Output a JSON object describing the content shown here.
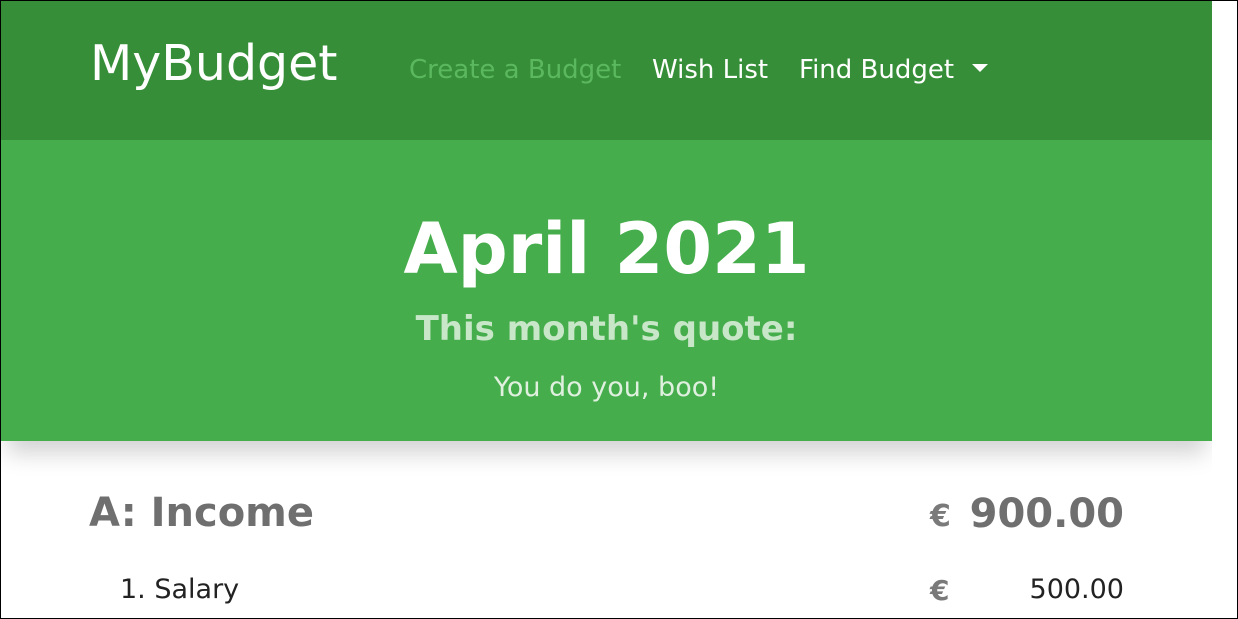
{
  "colors": {
    "navbar": "#368f38",
    "hero": "#45ad4b",
    "active_link": "#5cb85f",
    "text_muted": "#6f6f6f"
  },
  "navbar": {
    "brand": "MyBudget",
    "links": [
      {
        "label": "Create a Budget",
        "active": true
      },
      {
        "label": "Wish List",
        "active": false
      },
      {
        "label": "Find Budget",
        "dropdown": true,
        "icon": "caret-down-icon"
      }
    ]
  },
  "hero": {
    "title": "April 2021",
    "subtitle": "This month's quote:",
    "quote": "You do you, boo!"
  },
  "budget": {
    "sections": [
      {
        "title": "A: Income",
        "currency": "€",
        "total": "900.00",
        "items": [
          {
            "label": "1. Salary",
            "currency": "€",
            "amount": "500.00"
          }
        ]
      }
    ]
  }
}
